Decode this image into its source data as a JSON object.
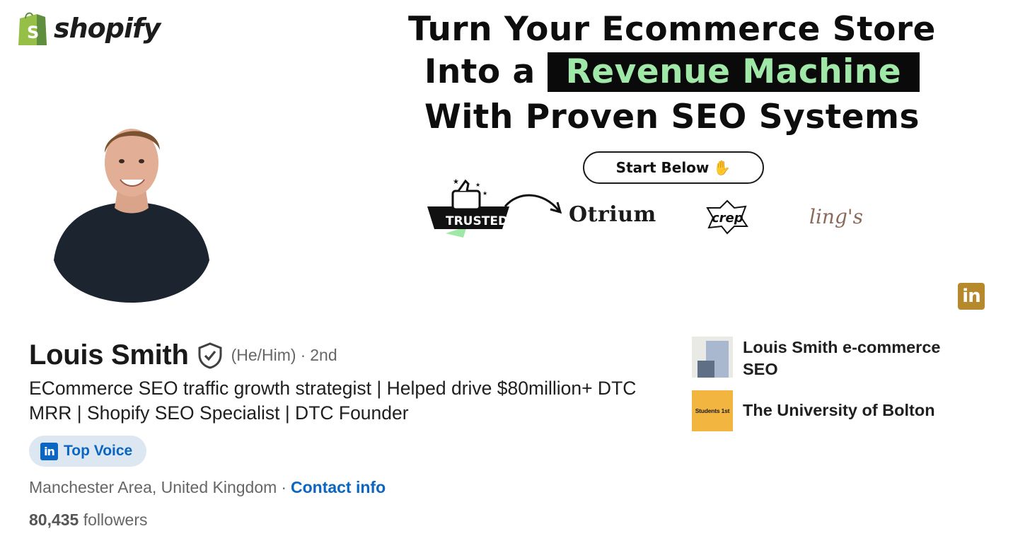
{
  "banner": {
    "brand_logo": "shopify",
    "headline_line1": "Turn Your  Ecommerce Store",
    "headline_line2_prefix": "Into a ",
    "headline_highlight": "Revenue Machine",
    "headline_line3": "With Proven SEO Systems",
    "cta_label": "Start Below",
    "cta_icon": "waving-hand-icon",
    "trusted_label": "TRUSTED",
    "brands": [
      "Otrium",
      "crep",
      "ling's"
    ],
    "highlight_color": "#9fe8a8"
  },
  "profile": {
    "name": "Louis Smith",
    "pronouns": "(He/Him)",
    "separator": "·",
    "degree": "2nd",
    "headline": "ECommerce SEO traffic growth strategist | Helped drive $80million+ DTC MRR | Shopify SEO Specialist | DTC Founder",
    "badge_label": "Top Voice",
    "location": "Manchester Area, United Kingdom",
    "contact_label": "Contact info",
    "followers_count": "80,435",
    "followers_label": "followers"
  },
  "organizations": {
    "company": "Louis Smith e-commerce SEO",
    "school": "The University of Bolton",
    "school_logo_text": "Students 1st"
  },
  "colors": {
    "linkedin_blue": "#0a66c2",
    "badge_gold": "#b7892d",
    "muted_text": "#666666"
  }
}
